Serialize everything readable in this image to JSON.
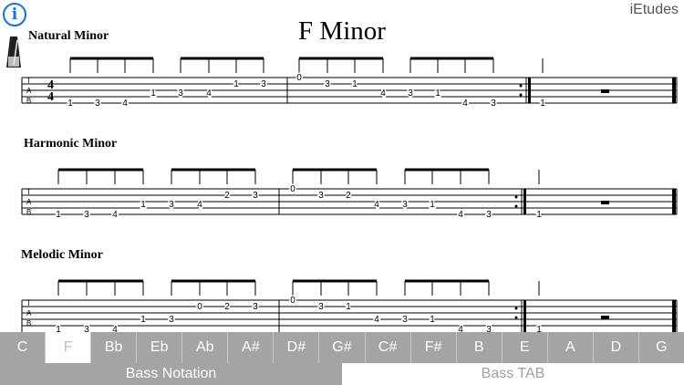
{
  "app": {
    "brand": "iEtudes",
    "info_label": "i"
  },
  "score": {
    "title": "F Minor",
    "sections": [
      {
        "label": "Natural Minor",
        "high_notes": [
          "1",
          "3",
          "0",
          "3",
          "1"
        ],
        "mid_notes": [
          "1",
          "3",
          "4",
          "1",
          "3",
          "4",
          "4",
          "3",
          "1"
        ],
        "low_notes": [
          "1",
          "3",
          "4",
          "4",
          "3",
          "1"
        ]
      },
      {
        "label": "Harmonic Minor",
        "high_notes": [
          "2",
          "3",
          "0",
          "3",
          "2"
        ],
        "mid_notes": [
          "1",
          "3",
          "4",
          "1",
          "3",
          "4",
          "4",
          "3",
          "1"
        ],
        "low_notes": [
          "1",
          "3",
          "4",
          "4",
          "3",
          "1"
        ]
      },
      {
        "label": "Melodic Minor",
        "high_notes": [
          "0",
          "2",
          "3",
          "0",
          "3",
          "1"
        ],
        "mid_notes": [
          "1",
          "3",
          "4",
          "3",
          "1"
        ],
        "low_notes": [
          "1",
          "3",
          "4",
          "4",
          "3",
          "1"
        ]
      }
    ]
  },
  "keys": [
    "C",
    "F",
    "Bb",
    "Eb",
    "Ab",
    "A#",
    "D#",
    "G#",
    "C#",
    "F#",
    "B",
    "E",
    "A",
    "D",
    "G"
  ],
  "selected_key": "F",
  "modes": [
    "Bass Notation",
    "Bass TAB"
  ],
  "active_mode": "Bass Notation"
}
